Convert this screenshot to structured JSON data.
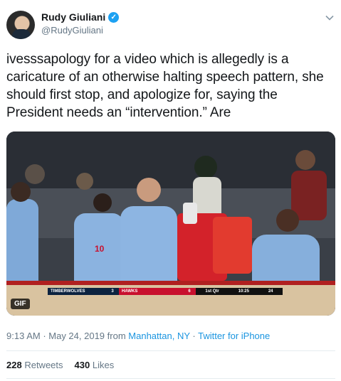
{
  "author": {
    "display_name": "Rudy Giuliani",
    "handle": "@RudyGiuliani",
    "verified_icon": "verified-badge-icon"
  },
  "tweet": {
    "text": "ivesssapology for a video which is allegedly is a caricature of an otherwise halting speech pattern, she should first stop, and apologize for, saying the President needs an “intervention.” Are"
  },
  "media": {
    "badge": "GIF",
    "scoreboard": {
      "team1": "TIMBERWOLVES",
      "score1": "3",
      "team2": "HAWKS",
      "score2": "6",
      "period": "1st Qtr",
      "clock": "10:25",
      "shot_clock": "24"
    },
    "jersey_number": "10"
  },
  "meta": {
    "time": "9:13 AM",
    "separator1": " · ",
    "date": "May 24, 2019",
    "from_text": " from ",
    "location": "Manhattan, NY",
    "separator2": " · ",
    "source": "Twitter for iPhone"
  },
  "stats": {
    "retweets_count": "228",
    "retweets_label": "Retweets",
    "likes_count": "430",
    "likes_label": "Likes"
  },
  "colors": {
    "link": "#1b95e0",
    "secondary_text": "#657786",
    "verified": "#1da1f2"
  }
}
